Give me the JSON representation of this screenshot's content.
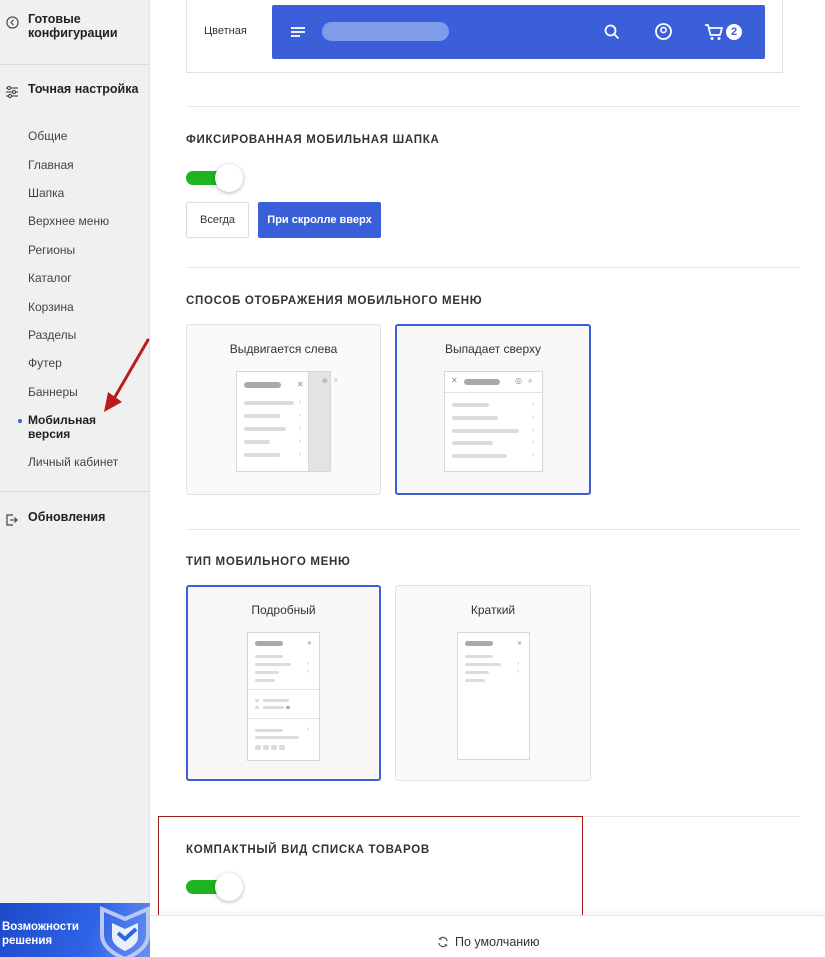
{
  "sidebar": {
    "ready_configs": "Готовые конфигурации",
    "fine_tuning": "Точная настройка",
    "items": [
      {
        "label": "Общие"
      },
      {
        "label": "Главная"
      },
      {
        "label": "Шапка"
      },
      {
        "label": "Верхнее меню"
      },
      {
        "label": "Регионы"
      },
      {
        "label": "Каталог"
      },
      {
        "label": "Корзина"
      },
      {
        "label": "Разделы"
      },
      {
        "label": "Футер"
      },
      {
        "label": "Баннеры"
      },
      {
        "label": "Мобильная версия"
      },
      {
        "label": "Личный кабинет"
      }
    ],
    "active_item": "Мобильная версия",
    "updates": "Обновления",
    "promo": "Возможности решения"
  },
  "header_preview": {
    "label": "Цветная",
    "cart_count": "2",
    "bar_color": "#3a5fd9"
  },
  "fixed_header": {
    "title": "ФИКСИРОВАННАЯ МОБИЛЬНАЯ ШАПКА",
    "toggle_on": true,
    "options": [
      "Всегда",
      "При скролле вверх"
    ],
    "selected": "При скролле вверх"
  },
  "menu_display": {
    "title": "СПОСОБ ОТОБРАЖЕНИЯ МОБИЛЬНОГО МЕНЮ",
    "options": [
      "Выдвигается слева",
      "Выпадает сверху"
    ],
    "selected": "Выпадает сверху"
  },
  "menu_type": {
    "title": "ТИП МОБИЛЬНОГО МЕНЮ",
    "options": [
      "Подробный",
      "Краткий"
    ],
    "selected": "Подробный"
  },
  "compact_list": {
    "title": "КОМПАКТНЫЙ ВИД СПИСКА ТОВАРОВ",
    "toggle_on": true
  },
  "footer": {
    "reset_label": "По умолчанию"
  },
  "colors": {
    "accent": "#3a5fd9",
    "toggle_on": "#1fb31f",
    "highlight": "#a31a1a"
  }
}
